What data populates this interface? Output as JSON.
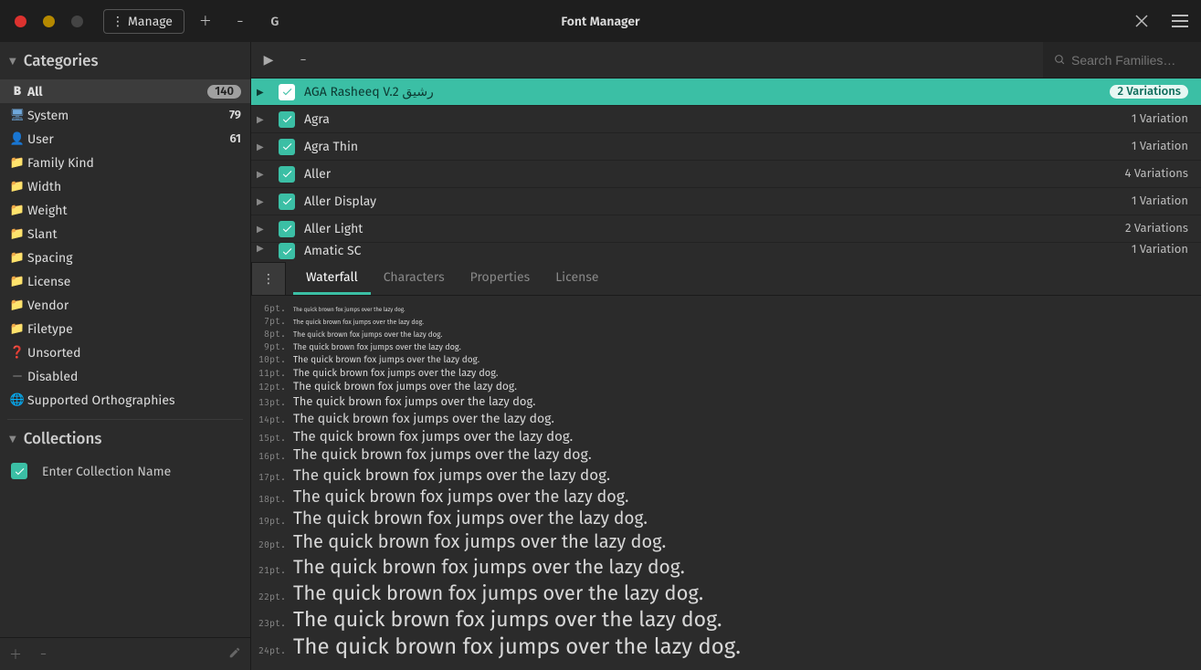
{
  "app": {
    "title": "Font Manager",
    "manage_label": "Manage",
    "g_label": "G"
  },
  "sidebar": {
    "categories_header": "Categories",
    "collections_header": "Collections",
    "categories": [
      {
        "icon": "B",
        "icon_class": "bold",
        "label": "All",
        "count": "140",
        "selected": true
      },
      {
        "icon": "🖥",
        "icon_class": "blue",
        "label": "System",
        "count": "79"
      },
      {
        "icon": "👤",
        "icon_class": "user",
        "label": "User",
        "count": "61"
      },
      {
        "icon": "📁",
        "icon_class": "folder",
        "label": "Family Kind"
      },
      {
        "icon": "📁",
        "icon_class": "folder",
        "label": "Width"
      },
      {
        "icon": "📁",
        "icon_class": "folder",
        "label": "Weight"
      },
      {
        "icon": "📁",
        "icon_class": "folder",
        "label": "Slant"
      },
      {
        "icon": "📁",
        "icon_class": "folder",
        "label": "Spacing"
      },
      {
        "icon": "📁",
        "icon_class": "folder",
        "label": "License"
      },
      {
        "icon": "📁",
        "icon_class": "folder",
        "label": "Vendor"
      },
      {
        "icon": "📁",
        "icon_class": "folder",
        "label": "Filetype"
      },
      {
        "icon": "❓",
        "icon_class": "mag",
        "label": "Unsorted"
      },
      {
        "icon": "—",
        "icon_class": "",
        "label": "Disabled"
      },
      {
        "icon": "🌐",
        "icon_class": "mag",
        "label": "Supported Orthographies"
      }
    ],
    "collections": [
      {
        "label": "Enter Collection Name",
        "checked": true
      }
    ]
  },
  "search": {
    "placeholder": "Search Families…"
  },
  "fonts": [
    {
      "name": "AGA Rasheeq V.2 رشيق",
      "variations": "2 Variations",
      "selected": true
    },
    {
      "name": "Agra",
      "variations": "1 Variation"
    },
    {
      "name": "Agra Thin",
      "variations": "1 Variation"
    },
    {
      "name": "Aller",
      "variations": "4 Variations"
    },
    {
      "name": "Aller Display",
      "variations": "1 Variation"
    },
    {
      "name": "Aller Light",
      "variations": "2 Variations"
    },
    {
      "name": "Amatic SC",
      "variations": "1 Variation",
      "cut": true
    }
  ],
  "tabs": {
    "items": [
      "Waterfall",
      "Characters",
      "Properties",
      "License"
    ],
    "active": 0
  },
  "waterfall": {
    "sample": "The quick brown fox jumps over the lazy dog.",
    "sizes": [
      6,
      7,
      8,
      9,
      10,
      11,
      12,
      13,
      14,
      15,
      16,
      17,
      18,
      19,
      20,
      21,
      22,
      23,
      24
    ]
  },
  "colors": {
    "accent": "#3bbfa5",
    "bg": "#2b2b2b",
    "bg_dark": "#1e1e1e"
  }
}
